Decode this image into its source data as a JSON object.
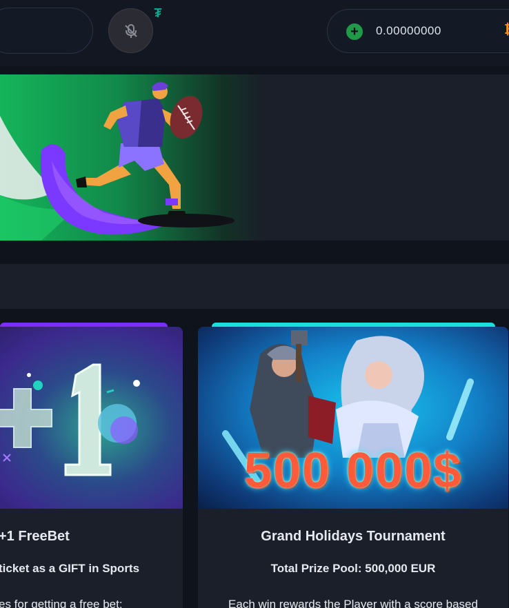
{
  "header": {
    "balance": "0.00000000",
    "plus_label": "+",
    "currency_icon": "bitcoin-icon",
    "badge_icon": "tether-icon",
    "mic_icon": "microphone-off-icon",
    "badge_glyph": "₮",
    "btc_glyph": "₿"
  },
  "banner": {
    "illustration": "football-player-illustration"
  },
  "promotions": [
    {
      "title": "+1 FreeBet",
      "subtitle": "ticket as a GIFT in Sports",
      "description": "es for getting a free bet:",
      "accent": "#7b2cff"
    },
    {
      "title": "Grand Holidays Tournament",
      "subtitle": "Total Prize Pool: 500,000 EUR",
      "description": "Each win rewards the Player with a score based",
      "image_text": "500 000$",
      "accent": "#18e0e0"
    }
  ],
  "colors": {
    "background": "#0f131c",
    "surface": "#1b1f2a",
    "green": "#1f9a49",
    "bitcoin": "#f7931a"
  }
}
